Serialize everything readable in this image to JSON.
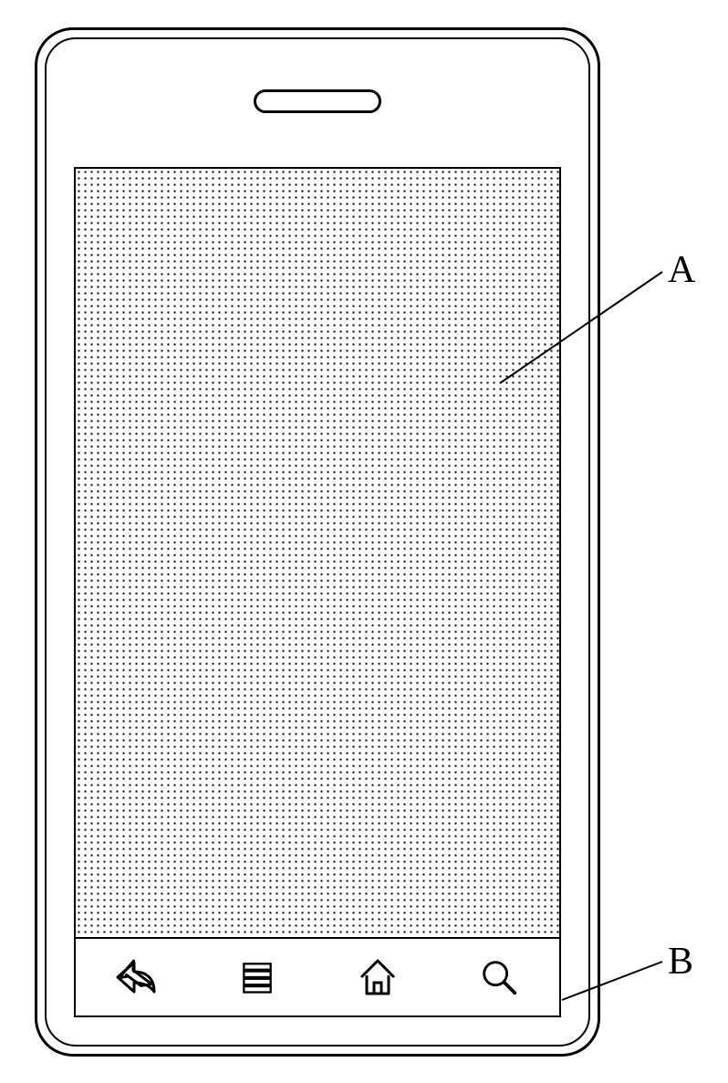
{
  "labels": {
    "a": "A",
    "b": "B"
  },
  "regions": {
    "a_description": "content-area",
    "b_description": "navigation-bar"
  },
  "nav": {
    "items": [
      {
        "name": "back-icon"
      },
      {
        "name": "menu-icon"
      },
      {
        "name": "home-icon"
      },
      {
        "name": "search-icon"
      }
    ]
  }
}
